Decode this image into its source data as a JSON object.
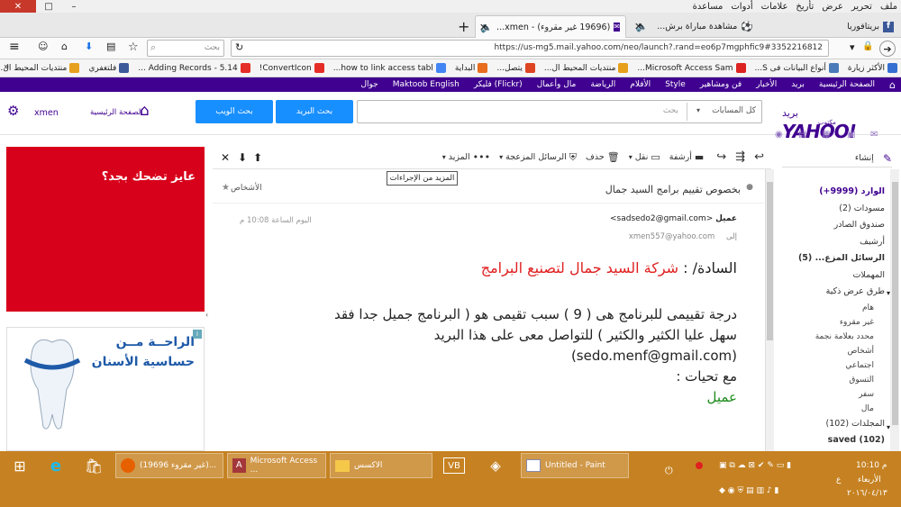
{
  "menubar": {
    "items": [
      "ملف",
      "تحرير",
      "عرض",
      "تأريخ",
      "علامات",
      "أدوات",
      "مساعدة"
    ]
  },
  "window": {
    "minimize": "–",
    "maximize": "□",
    "close": "✕"
  },
  "tabs": [
    {
      "label": "بريتافوريا",
      "icon": "facebook-icon"
    },
    {
      "label": "مشاهدة مباراة برش...",
      "icon": "soccer-icon"
    },
    {
      "label": "(19696 غير مقروء) - xmen...",
      "icon": "mail-icon"
    }
  ],
  "tab_new": "+",
  "nav": {
    "url": "https://us-mg5.mail.yahoo.com/neo/launch?.rand=eo6p7mgphfic9#3352216812",
    "search_placeholder": "بحث"
  },
  "bookmarks": [
    "الأكثر زيارة",
    "أنواع البيانات فى S...",
    "Microsoft Access Sam...",
    "منتديات المحيط ال...",
    "يتصل...",
    "البداية",
    "how to link access tabl...",
    "ConvertIcon!",
    "5.14 - Adding Records ...",
    "فلتغفري",
    "منتديات المحيط ال..."
  ],
  "ybar": [
    "الصفحة الرئيسية",
    "بريد",
    "الأخبار",
    "فن ومشاهير",
    "Style",
    "الأفلام",
    "الرياضة",
    "مال وأعمال",
    "(Flickr) فليكر",
    "Maktoob English",
    "جوال"
  ],
  "header": {
    "logo": "YAHOO!",
    "logo_sub": "مكتوب",
    "logo_mail": "بريد",
    "search_scope": "كل المسابات",
    "search_placeholder": "بحث",
    "search_mail_btn": "بحث البريد",
    "search_web_btn": "بحث الويب",
    "home_label": "الصفحة الرئيسية",
    "user": "xmen"
  },
  "ad": {
    "text": "عايز تضحك بجد؟",
    "ad2_line1": "الراحــة مــن",
    "ad2_line2": "حساسية الأسنان"
  },
  "toolbar": {
    "compose": "إنشاء",
    "archive": "أرشفة",
    "move": "نقل",
    "delete": "حذف",
    "spam": "الرسائل المزعجة",
    "more": "المزيد",
    "tooltip": "المزيد من الإجراءات"
  },
  "message": {
    "subject": "بخصوص تقييم برامج السيد جمال",
    "people": "الأشخاص",
    "from_name": "عميل",
    "from_email": "<sadsedo2@gmail.com>",
    "to_label": "إلى",
    "to_email": "xmen557@yahoo.com",
    "time": "اليوم الساعة 10:08 م",
    "greeting_prefix": "السادة/ :",
    "greeting_company": "شركة السيد جمال لتصنيع البرامج",
    "body_line1": "درجة تقييمى للبرنامج هى ( 9 ) سبب تقيمى هو ( البرنامج جميل جدا فقد",
    "body_line2": "سهل عليا الكثير والكثير ) للتواصل معى على هذا البريد",
    "body_line3": "(sedo.menf@gmail.com)",
    "closing": "مع تحيات :",
    "signature": "عميل"
  },
  "folders": [
    {
      "label": "الوارد (9999+)",
      "bold": true,
      "color": "#400090"
    },
    {
      "label": "مسودات (2)"
    },
    {
      "label": "صندوق الصادر"
    },
    {
      "label": "أرشيف"
    },
    {
      "label": "الرسائل المزع... (5)",
      "bold": true
    },
    {
      "label": "المهملات"
    },
    {
      "label": "طرق عرض ذكية"
    },
    {
      "label": "هام",
      "sub": true
    },
    {
      "label": "غير مقروء",
      "sub": true
    },
    {
      "label": "محدد بعلامة نجمة",
      "sub": true
    },
    {
      "label": "أشخاص",
      "sub": true
    },
    {
      "label": "اجتماعي",
      "sub": true
    },
    {
      "label": "التسوق",
      "sub": true
    },
    {
      "label": "سفر",
      "sub": true
    },
    {
      "label": "مال",
      "sub": true
    },
    {
      "label": "المجلدات (102)"
    },
    {
      "label": "saved (102)",
      "bold": true
    }
  ],
  "taskbar": {
    "items": [
      {
        "label": "(19696 غير مقروء)..."
      },
      {
        "label": "Microsoft Access ..."
      },
      {
        "label": "الاكسس"
      },
      {
        "label": "Untitled - Paint"
      }
    ],
    "time": "10:10 م",
    "day": "الأربعاء",
    "date": "٢٠١٦/٠٤/١٣",
    "lang": "ع"
  }
}
